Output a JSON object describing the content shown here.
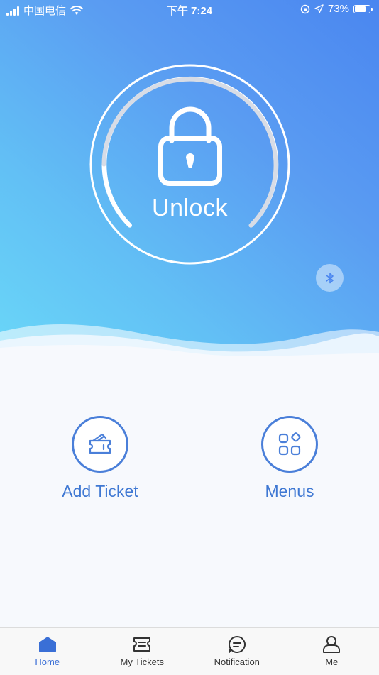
{
  "status_bar": {
    "carrier": "中国电信",
    "time": "下午 7:24",
    "battery": "73%",
    "battery_level": 0.73
  },
  "hero": {
    "unlock_label": "Unlock",
    "bluetooth_icon": "bluetooth-icon"
  },
  "actions": [
    {
      "label": "Add Ticket",
      "icon": "ticket-icon"
    },
    {
      "label": "Menus",
      "icon": "menus-grid-icon"
    }
  ],
  "tabs": [
    {
      "label": "Home",
      "icon": "home-icon",
      "active": true
    },
    {
      "label": "My Tickets",
      "icon": "tickets-icon",
      "active": false
    },
    {
      "label": "Notification",
      "icon": "notification-icon",
      "active": false
    },
    {
      "label": "Me",
      "icon": "person-icon",
      "active": false
    }
  ],
  "colors": {
    "accent": "#3a6fd6",
    "gradient_start": "#4a86f0",
    "gradient_end": "#6ad8f8"
  }
}
